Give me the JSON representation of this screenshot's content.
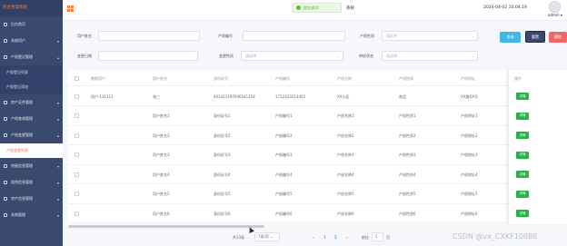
{
  "sidebar": {
    "brand": "后台管理系统",
    "items": [
      {
        "label": "后台首页"
      },
      {
        "label": "系统用户"
      },
      {
        "label": "产权登记管理"
      }
    ],
    "sub_items": [
      {
        "label": "产权登记列表",
        "active": false
      },
      {
        "label": "产权登记添加",
        "active": false
      }
    ],
    "items2": [
      {
        "label": "房产证件管理"
      },
      {
        "label": "产权查询管理"
      },
      {
        "label": "产权变更管理"
      }
    ],
    "sub_items2": [
      {
        "label": "产权变更列表",
        "active": true
      }
    ],
    "items3": [
      {
        "label": "房屋信息管理"
      },
      {
        "label": "租赁信息管理"
      },
      {
        "label": "房产信息管理"
      },
      {
        "label": "系统管理"
      }
    ]
  },
  "header": {
    "title": "系统",
    "datetime": "2024-04-02 10:04:19",
    "username": "admin",
    "toast": "提交成功!"
  },
  "search": {
    "fields": [
      {
        "label": "用户姓名",
        "placeholder": "",
        "dropdown": false
      },
      {
        "label": "产权编号",
        "placeholder": "",
        "dropdown": false
      },
      {
        "label": "产权性质",
        "placeholder": "请选择",
        "dropdown": true
      },
      {
        "label": "变更日期",
        "placeholder": "",
        "dropdown": false
      },
      {
        "label": "变更性质",
        "placeholder": "请选择",
        "dropdown": true
      },
      {
        "label": "审核状态",
        "placeholder": "请选择",
        "dropdown": true
      }
    ],
    "buttons": {
      "query": "查询",
      "reset": "重置",
      "delete": "删除"
    }
  },
  "table": {
    "headers": [
      "",
      "数据用户",
      "用户姓名",
      "身份证号",
      "产权编号",
      "产权名称",
      "产权性质",
      "产权地址",
      "操作"
    ],
    "rows": [
      [
        "用户-111111",
        "张三",
        "441421197606541154",
        "1712323213455",
        "XX小区",
        "商品",
        "XX路XX号"
      ],
      [
        "",
        "用户姓名1",
        "身份证号1",
        "产权编号1",
        "产权名称1",
        "产权性质1",
        "产权地址1"
      ],
      [
        "",
        "用户姓名2",
        "身份证号2",
        "产权编号2",
        "产权名称2",
        "产权性质2",
        "产权地址2"
      ],
      [
        "",
        "用户姓名3",
        "身份证号3",
        "产权编号3",
        "产权名称3",
        "产权性质3",
        "产权地址3"
      ],
      [
        "",
        "用户姓名4",
        "身份证号4",
        "产权编号4",
        "产权名称4",
        "产权性质4",
        "产权地址4"
      ],
      [
        "",
        "用户姓名5",
        "身份证号5",
        "产权编号5",
        "产权名称5",
        "产权性质5",
        "产权地址5"
      ],
      [
        "",
        "用户姓名6",
        "身份证号6",
        "产权编号6",
        "产权名称6",
        "产权性质6",
        "产权地址6"
      ]
    ],
    "action_label": "详情"
  },
  "pagination": {
    "total": "共13条",
    "page_size": "7条/页",
    "prev": "‹",
    "next": "›",
    "pages": [
      "1",
      "2"
    ],
    "current": "2",
    "goto_label": "前往",
    "goto_value": "1",
    "goto_suffix": "页"
  },
  "watermark": "CSDN @vx_CXKF10088",
  "colors": {
    "sidebar_bg": "#3a4a6e",
    "accent": "#ff7a3d",
    "query_btn": "#3fb8e6",
    "reset_btn": "#3b4a6a",
    "delete_btn": "#f06767",
    "edit_btn": "#27b24a"
  }
}
